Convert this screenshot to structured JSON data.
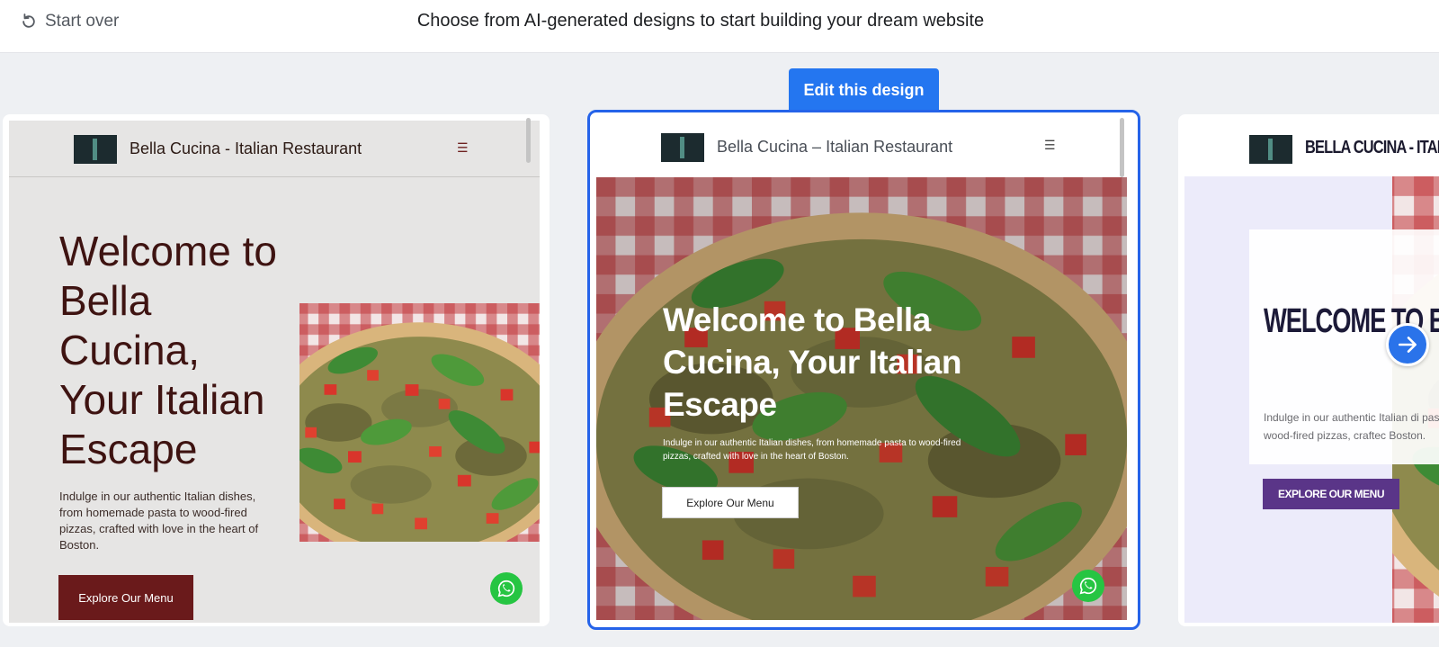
{
  "topbar": {
    "start_over_label": "Start over",
    "title": "Choose from AI-generated designs to start building your dream website"
  },
  "edit_button_label": "Edit this design",
  "designs": [
    {
      "brand": "Bella Cucina - Italian Restaurant",
      "heading": "Welcome to Bella Cucina, Your Italian Escape",
      "text": "Indulge in our authentic Italian dishes, from homemade pasta to wood-fired pizzas, crafted with love in the heart of Boston.",
      "button": "Explore Our Menu"
    },
    {
      "brand": "Bella Cucina – Italian Restaurant",
      "heading": "Welcome to Bella Cucina, Your Italian Escape",
      "text": "Indulge in our authentic Italian dishes, from homemade pasta to wood-fired pizzas, crafted with love in the heart of Boston.",
      "button": "Explore Our Menu"
    },
    {
      "brand": "BELLA CUCINA - ITALIA",
      "heading": "WELCOME TO BE YOUR ITALIAN ES",
      "text": "Indulge in our authentic Italian di pasta to wood-fired pizzas, craftec Boston.",
      "button": "EXPLORE OUR MENU"
    }
  ],
  "colors": {
    "accent": "#2476f0",
    "selected_border": "#2563e9",
    "whatsapp": "#26c542",
    "left_button": "#6a1a1b",
    "right_button": "#5a3588"
  },
  "icons": {
    "start_over": "refresh-icon",
    "menu": "hamburger-icon",
    "whatsapp": "whatsapp-icon",
    "next": "arrow-right-icon"
  }
}
